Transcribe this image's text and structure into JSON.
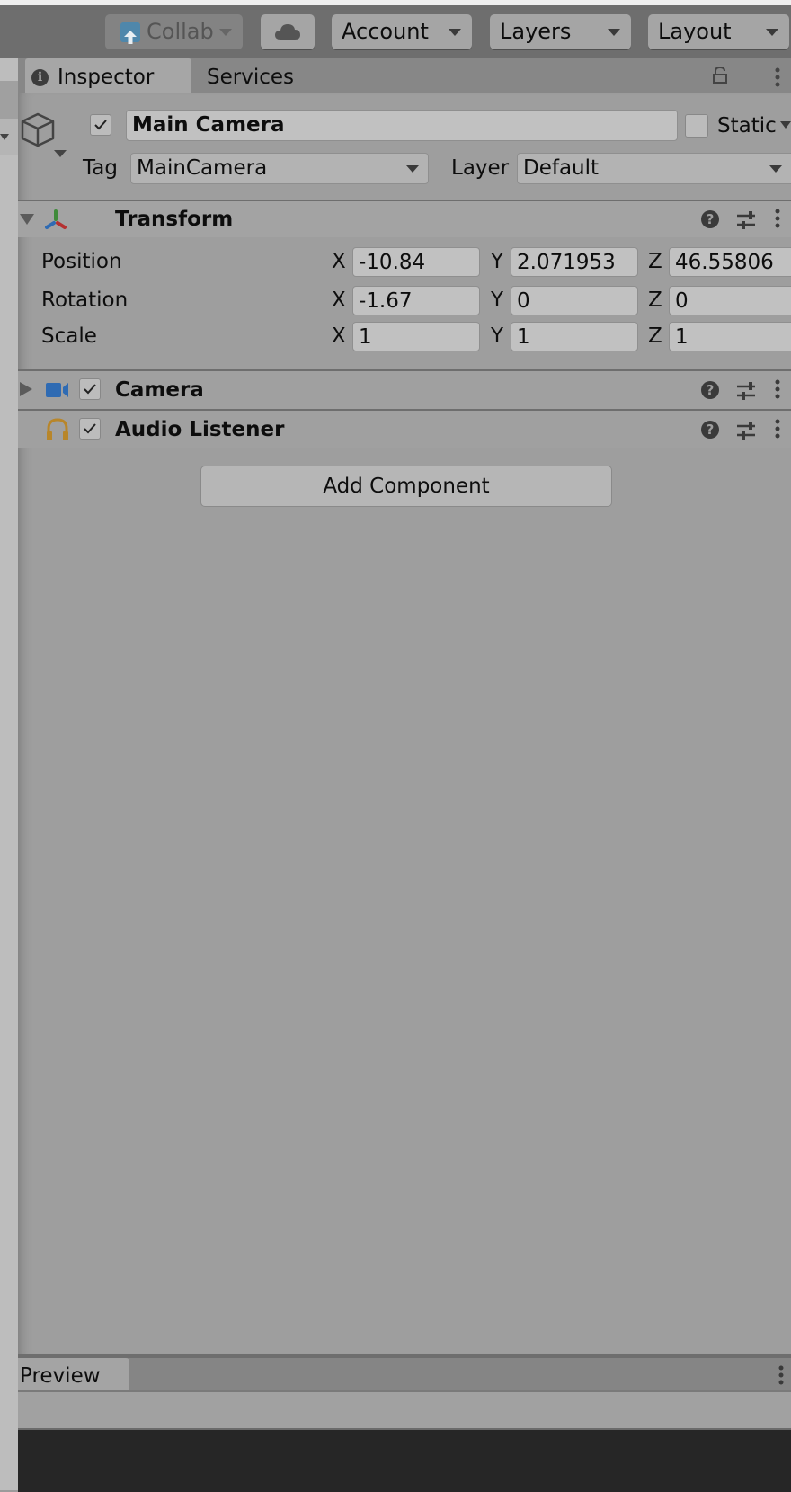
{
  "toolbar": {
    "collab_label": "Collab",
    "account_label": "Account",
    "layers_label": "Layers",
    "layout_label": "Layout"
  },
  "tabs": {
    "inspector": "Inspector",
    "services": "Services"
  },
  "object": {
    "active": true,
    "name": "Main Camera",
    "static_label": "Static",
    "static_checked": false,
    "tag_label": "Tag",
    "tag_value": "MainCamera",
    "layer_label": "Layer",
    "layer_value": "Default"
  },
  "transform": {
    "title": "Transform",
    "rows": [
      {
        "label": "Position",
        "x": "-10.84",
        "y": "2.071953",
        "z": "46.55806"
      },
      {
        "label": "Rotation",
        "x": "-1.67",
        "y": "0",
        "z": "0"
      },
      {
        "label": "Scale",
        "x": "1",
        "y": "1",
        "z": "1"
      }
    ],
    "axis_labels": {
      "x": "X",
      "y": "Y",
      "z": "Z"
    }
  },
  "components": [
    {
      "title": "Camera",
      "enabled": true,
      "icon": "camera-icon",
      "icon_color": "#2f6bb3"
    },
    {
      "title": "Audio Listener",
      "enabled": true,
      "icon": "headphones-icon",
      "icon_color": "#b8862a"
    }
  ],
  "add_component_label": "Add Component",
  "preview": {
    "tab_label": "Preview"
  },
  "colors": {
    "toolbar_bg": "#6e6e6e",
    "inspector_bg": "#9e9e9e",
    "collab_icon": "#4f87ab",
    "axis_green": "#3f8a3a",
    "axis_blue": "#2f6bb3",
    "axis_red": "#b53131"
  }
}
